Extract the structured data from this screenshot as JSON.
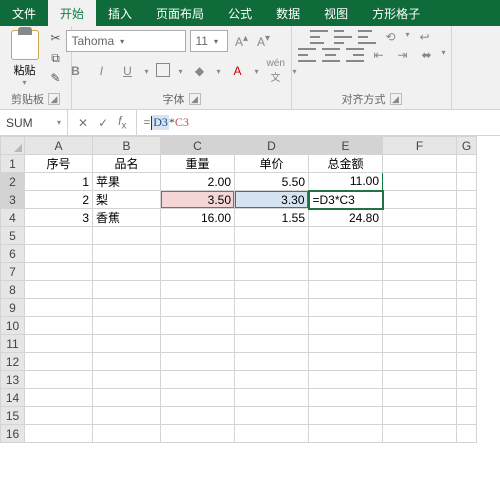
{
  "tabs": [
    "文件",
    "开始",
    "插入",
    "页面布局",
    "公式",
    "数据",
    "视图",
    "方形格子"
  ],
  "activeTab": 1,
  "ribbon": {
    "clipboard": {
      "paste": "粘贴",
      "label": "剪贴板"
    },
    "font": {
      "name": "Tahoma",
      "size": "11",
      "label": "字体",
      "bold": "B",
      "italic": "I",
      "underline": "U",
      "wen": "wén 文"
    },
    "align": {
      "label": "对齐方式"
    }
  },
  "nameBox": "SUM",
  "formula": {
    "eq": "=",
    "d3": "D3",
    "star": "*",
    "c3": "C3"
  },
  "columns": [
    "A",
    "B",
    "C",
    "D",
    "E",
    "F",
    "G"
  ],
  "rows": [
    "1",
    "2",
    "3",
    "4",
    "5",
    "6",
    "7",
    "8",
    "9",
    "10",
    "11",
    "12",
    "13",
    "14",
    "15",
    "16"
  ],
  "data": {
    "r1": {
      "A": "序号",
      "B": "品名",
      "C": "重量",
      "D": "单价",
      "E": "总金额"
    },
    "r2": {
      "A": "1",
      "B": "苹果",
      "C": "2.00",
      "D": "5.50",
      "E": "11.00"
    },
    "r3": {
      "A": "2",
      "B": "梨",
      "C": "3.50",
      "D": "3.30",
      "E": "=D3*C3"
    },
    "r4": {
      "A": "3",
      "B": "香蕉",
      "C": "16.00",
      "D": "1.55",
      "E": "24.80"
    }
  },
  "chart_data": {
    "type": "table",
    "title": "",
    "columns": [
      "序号",
      "品名",
      "重量",
      "单价",
      "总金额"
    ],
    "rows": [
      [
        1,
        "苹果",
        2.0,
        5.5,
        11.0
      ],
      [
        2,
        "梨",
        3.5,
        3.3,
        null
      ],
      [
        3,
        "香蕉",
        16.0,
        1.55,
        24.8
      ]
    ],
    "editing": {
      "cell": "E3",
      "formula": "=D3*C3"
    }
  }
}
